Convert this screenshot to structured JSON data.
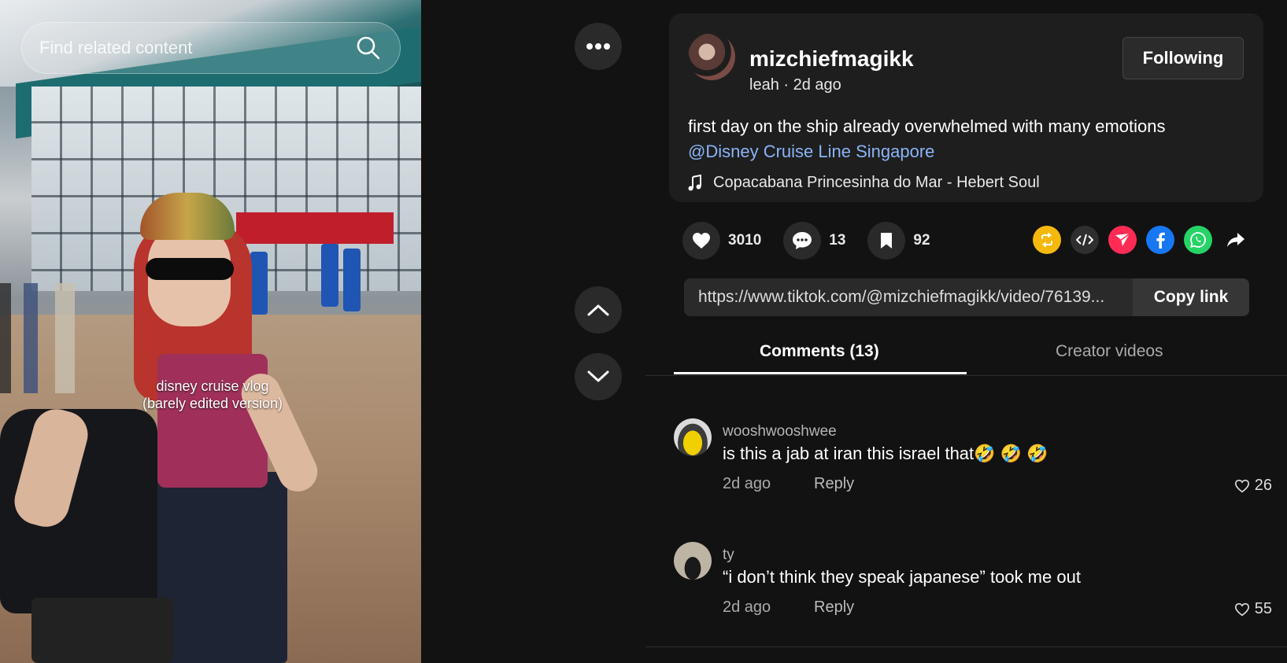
{
  "video": {
    "overlay_line1": "disney cruise vlog",
    "overlay_line2": "(barely edited version)",
    "search_placeholder": "Find related content"
  },
  "controls": {
    "more_icon": "more-horizontal-icon",
    "up_icon": "chevron-up-icon",
    "down_icon": "chevron-down-icon"
  },
  "post": {
    "username": "mizchiefmagikk",
    "display_name": "leah",
    "separator": " · ",
    "posted": "2d ago",
    "follow_label": "Following",
    "description": "first day on the ship already overwhelmed with many emotions",
    "mention": "@Disney Cruise Line Singapore",
    "music": "Copacabana Princesinha do Mar - Hebert Soul"
  },
  "stats": {
    "likes": "3010",
    "comments": "13",
    "saves": "92"
  },
  "share": {
    "icons": [
      "repost-icon",
      "embed-icon",
      "send-icon",
      "facebook-icon",
      "whatsapp-icon",
      "share-arrow-icon"
    ],
    "colors": {
      "repost": "#f5b90c",
      "embed": "#2f2f2f",
      "send": "#fe2c55",
      "facebook": "#1877f2",
      "whatsapp": "#25d366"
    }
  },
  "link": {
    "url": "https://www.tiktok.com/@mizchiefmagikk/video/76139...",
    "copy_label": "Copy link"
  },
  "tabs": {
    "comments": "Comments (13)",
    "creator": "Creator videos"
  },
  "comments": [
    {
      "user": "wooshwooshwee",
      "text": "is this a jab at iran this israel that🤣 🤣 🤣",
      "time": "2d ago",
      "reply": "Reply",
      "likes": "26"
    },
    {
      "user": "ty",
      "text": "“i don’t think they speak japanese” took me out",
      "time": "2d ago",
      "reply": "Reply",
      "likes": "55"
    }
  ]
}
